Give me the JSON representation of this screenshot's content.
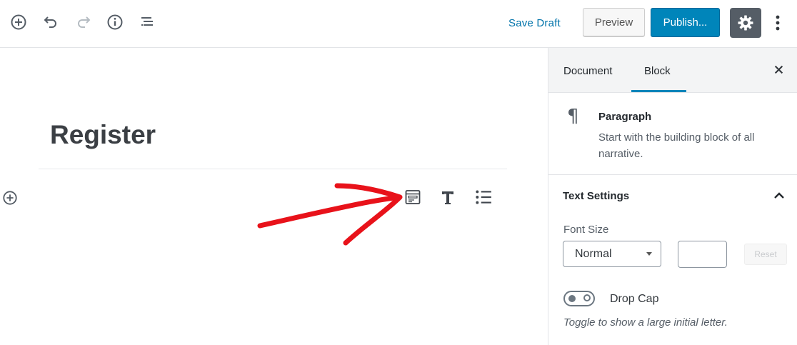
{
  "toolbar": {
    "icons": [
      "add-block-icon",
      "undo-icon",
      "redo-icon",
      "info-icon",
      "block-navigation-icon"
    ],
    "save_draft": "Save Draft",
    "preview": "Preview",
    "publish": "Publish...",
    "settings_icon": "gear-icon",
    "more_icon": "more-vertical-icon"
  },
  "editor": {
    "title": "Register",
    "suggested_blocks": [
      "form-block-icon",
      "heading-icon",
      "list-icon"
    ],
    "annotation": "red-arrow"
  },
  "sidebar": {
    "tabs": [
      "Document",
      "Block"
    ],
    "active_tab": "Block",
    "block": {
      "name": "Paragraph",
      "description": "Start with the building block of all narrative.",
      "icon": "¶"
    },
    "text_settings": {
      "title": "Text Settings",
      "font_size_label": "Font Size",
      "font_size_value": "Normal",
      "custom_size_value": "",
      "reset": "Reset",
      "drop_cap_label": "Drop Cap",
      "drop_cap_help": "Toggle to show a large initial letter.",
      "drop_cap_enabled": false
    }
  },
  "colors": {
    "accent": "#0085ba",
    "link": "#0073aa",
    "arrow": "#e8121a"
  }
}
